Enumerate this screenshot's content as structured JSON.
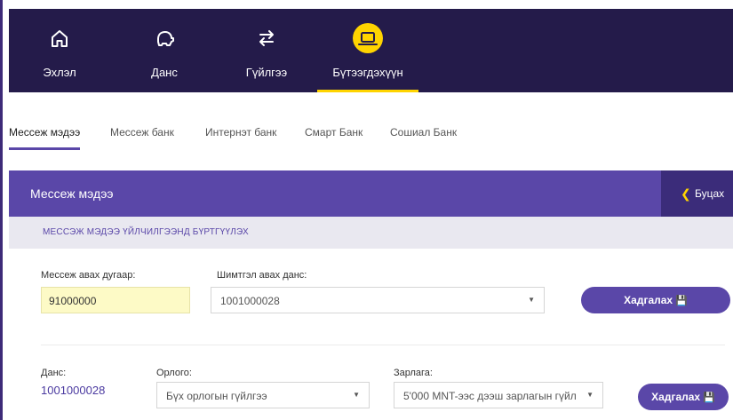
{
  "nav": {
    "items": [
      {
        "label": "Эхлэл",
        "icon": "home-icon"
      },
      {
        "label": "Данс",
        "icon": "piggy-bank-icon"
      },
      {
        "label": "Гүйлгээ",
        "icon": "transfer-icon"
      },
      {
        "label": "Бүтээгдэхүүн",
        "icon": "laptop-icon",
        "active": true
      }
    ]
  },
  "tabs": [
    {
      "label": "Мессеж мэдээ",
      "active": true
    },
    {
      "label": "Мессеж банк"
    },
    {
      "label": "Интернэт банк"
    },
    {
      "label": "Смарт Банк"
    },
    {
      "label": "Сошиал Банк"
    }
  ],
  "header": {
    "title": "Мессеж мэдээ",
    "back_label": "Буцах"
  },
  "subheader": "МЕССЭЖ МЭДЭЭ ҮЙЛЧИЛГЭЭНД БҮРТГҮҮЛЭХ",
  "form1": {
    "phone_label": "Мессеж авах дугаар:",
    "phone_value": "91000000",
    "account_label": "Шимтгэл авах данс:",
    "account_value": "1001000028",
    "save_label": "Хадгалах"
  },
  "form2": {
    "account_label": "Данс:",
    "account_value": "1001000028",
    "income_label": "Орлого:",
    "income_value": "Бүх орлогын гүйлгээ",
    "expense_label": "Зарлага:",
    "expense_value": "5'000 MNT-ээс дээш зарлагын гүйл",
    "save_label": "Хадгалах"
  },
  "colors": {
    "nav_bg": "#241b4a",
    "accent": "#ffd400",
    "brand": "#5a47a8",
    "band_dark": "#3b2c7a"
  }
}
